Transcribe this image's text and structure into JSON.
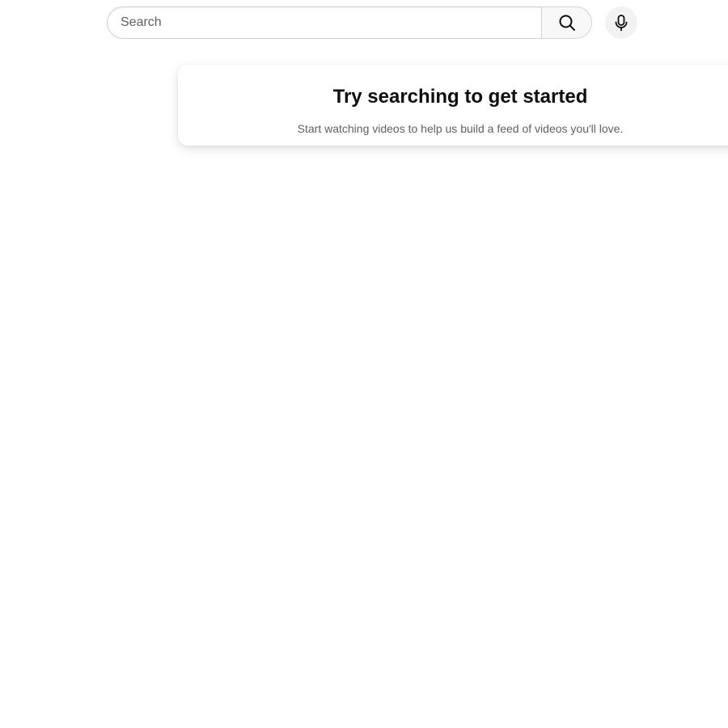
{
  "search": {
    "placeholder": "Search",
    "value": "",
    "button_icon": "search-icon",
    "voice_icon": "microphone-icon"
  },
  "prompt": {
    "title": "Try searching to get started",
    "subtitle": "Start watching videos to help us build a feed of videos you'll love."
  },
  "colors": {
    "text_primary": "#0f0f0f",
    "text_secondary": "#606060",
    "search_border": "#cfcfcf",
    "search_button_bg": "#f8f8f8",
    "mic_button_bg": "#f2f2f2",
    "background": "#ffffff"
  }
}
